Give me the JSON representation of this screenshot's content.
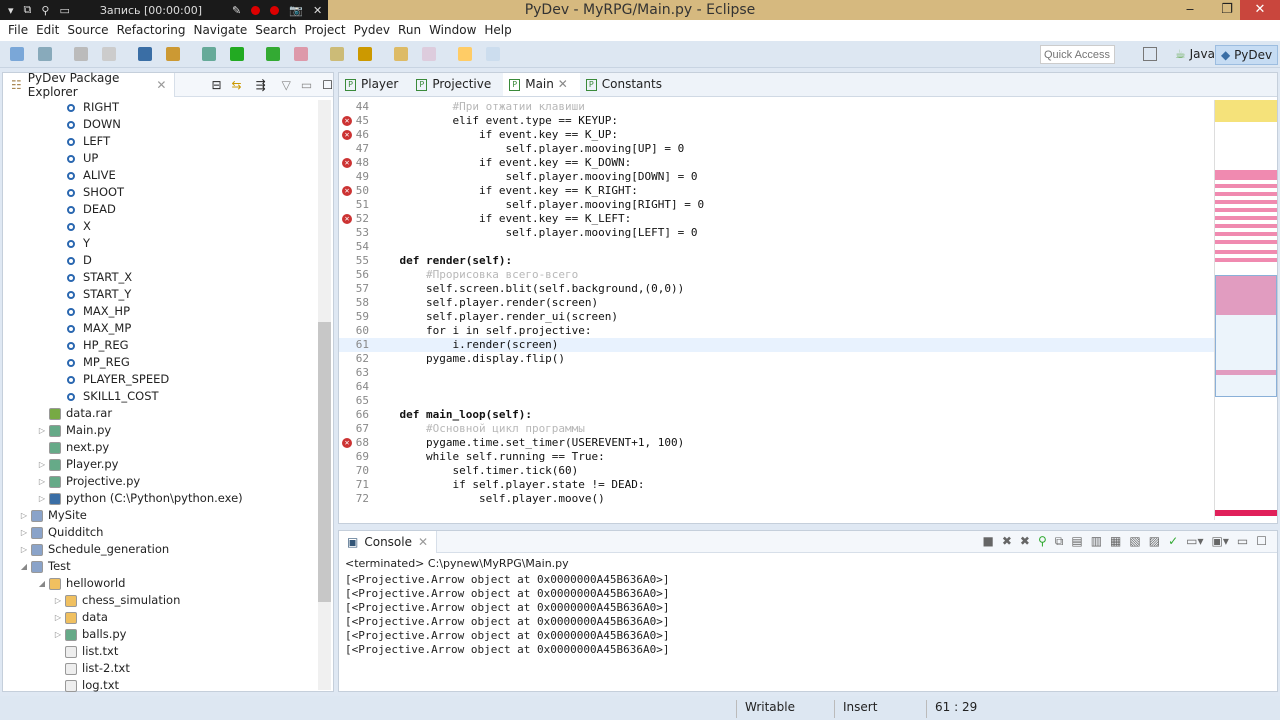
{
  "recorder": {
    "label": "Запись [00:00:00]"
  },
  "window": {
    "title": "PyDev - MyRPG/Main.py - Eclipse",
    "minimize": "‒",
    "restore": "❐",
    "close": "✕"
  },
  "menu": [
    "File",
    "Edit",
    "Source",
    "Refactoring",
    "Navigate",
    "Search",
    "Project",
    "Pydev",
    "Run",
    "Window",
    "Help"
  ],
  "toolbar": {
    "quick_access_placeholder": "Quick Access",
    "perspectives": [
      "Java",
      "PyDev"
    ]
  },
  "explorer": {
    "title": "PyDev Package Explorer",
    "items": [
      {
        "label": "RIGHT",
        "type": "const",
        "indent": 1
      },
      {
        "label": "DOWN",
        "type": "const",
        "indent": 1
      },
      {
        "label": "LEFT",
        "type": "const",
        "indent": 1
      },
      {
        "label": "UP",
        "type": "const",
        "indent": 1
      },
      {
        "label": "ALIVE",
        "type": "const",
        "indent": 1
      },
      {
        "label": "SHOOT",
        "type": "const",
        "indent": 1
      },
      {
        "label": "DEAD",
        "type": "const",
        "indent": 1
      },
      {
        "label": "X",
        "type": "const",
        "indent": 1
      },
      {
        "label": "Y",
        "type": "const",
        "indent": 1
      },
      {
        "label": "D",
        "type": "const",
        "indent": 1
      },
      {
        "label": "START_X",
        "type": "const",
        "indent": 1
      },
      {
        "label": "START_Y",
        "type": "const",
        "indent": 1
      },
      {
        "label": "MAX_HP",
        "type": "const",
        "indent": 1
      },
      {
        "label": "MAX_MP",
        "type": "const",
        "indent": 1
      },
      {
        "label": "HP_REG",
        "type": "const",
        "indent": 1
      },
      {
        "label": "MP_REG",
        "type": "const",
        "indent": 1
      },
      {
        "label": "PLAYER_SPEED",
        "type": "const",
        "indent": 1
      },
      {
        "label": "SKILL1_COST",
        "type": "const",
        "indent": 1
      },
      {
        "label": "data.rar",
        "type": "archive",
        "indent": 0
      },
      {
        "label": "Main.py",
        "type": "py",
        "indent": 0,
        "arrow": true
      },
      {
        "label": "next.py",
        "type": "py",
        "indent": 0
      },
      {
        "label": "Player.py",
        "type": "py",
        "indent": 0,
        "arrow": true
      },
      {
        "label": "Projective.py",
        "type": "py",
        "indent": 0,
        "arrow": true
      },
      {
        "label": "python  (C:\\Python\\python.exe)",
        "type": "python",
        "indent": 0,
        "arrow": true
      },
      {
        "label": "MySite",
        "type": "project",
        "indent": -1,
        "arrow": true
      },
      {
        "label": "Quidditch",
        "type": "project",
        "indent": -1,
        "arrow": true
      },
      {
        "label": "Schedule_generation",
        "type": "project",
        "indent": -1,
        "arrow": true
      },
      {
        "label": "Test",
        "type": "project",
        "indent": -1,
        "arrow": true,
        "open": true
      },
      {
        "label": "helloworld",
        "type": "folder",
        "indent": 0,
        "arrow": true,
        "open": true
      },
      {
        "label": "chess_simulation",
        "type": "folder",
        "indent": 1,
        "arrow": true
      },
      {
        "label": "data",
        "type": "folder",
        "indent": 1,
        "arrow": true
      },
      {
        "label": "balls.py",
        "type": "py",
        "indent": 1,
        "arrow": true
      },
      {
        "label": "list.txt",
        "type": "txt",
        "indent": 1
      },
      {
        "label": "list-2.txt",
        "type": "txt",
        "indent": 1
      },
      {
        "label": "log.txt",
        "type": "txt",
        "indent": 1
      }
    ]
  },
  "editor": {
    "tabs": [
      {
        "label": "Player"
      },
      {
        "label": "Projective"
      },
      {
        "label": "Main",
        "active": true
      },
      {
        "label": "Constants"
      }
    ],
    "current_line": 61,
    "lines": [
      {
        "n": 44,
        "t": "            #При отжатии клавиши"
      },
      {
        "n": 45,
        "t": "            elif event.type == KEYUP:",
        "e": true
      },
      {
        "n": 46,
        "t": "                if event.key == K_UP:",
        "e": true
      },
      {
        "n": 47,
        "t": "                    self.player.mooving[UP] = 0"
      },
      {
        "n": 48,
        "t": "                if event.key == K_DOWN:",
        "e": true
      },
      {
        "n": 49,
        "t": "                    self.player.mooving[DOWN] = 0"
      },
      {
        "n": 50,
        "t": "                if event.key == K_RIGHT:",
        "e": true
      },
      {
        "n": 51,
        "t": "                    self.player.mooving[RIGHT] = 0"
      },
      {
        "n": 52,
        "t": "                if event.key == K_LEFT:",
        "e": true
      },
      {
        "n": 53,
        "t": "                    self.player.mooving[LEFT] = 0"
      },
      {
        "n": 54,
        "t": ""
      },
      {
        "n": 55,
        "t": "    def render(self):"
      },
      {
        "n": 56,
        "t": "        #Прорисовка всего-всего"
      },
      {
        "n": 57,
        "t": "        self.screen.blit(self.background,(0,0))"
      },
      {
        "n": 58,
        "t": "        self.player.render(screen)"
      },
      {
        "n": 59,
        "t": "        self.player.render_ui(screen)"
      },
      {
        "n": 60,
        "t": "        for i in self.projective:"
      },
      {
        "n": 61,
        "t": "            i.render(screen)"
      },
      {
        "n": 62,
        "t": "        pygame.display.flip()"
      },
      {
        "n": 63,
        "t": ""
      },
      {
        "n": 64,
        "t": ""
      },
      {
        "n": 65,
        "t": ""
      },
      {
        "n": 66,
        "t": "    def main_loop(self):"
      },
      {
        "n": 67,
        "t": "        #Основной цикл программы"
      },
      {
        "n": 68,
        "t": "        pygame.time.set_timer(USEREVENT+1, 100)",
        "e": true
      },
      {
        "n": 69,
        "t": "        while self.running == True:"
      },
      {
        "n": 70,
        "t": "            self.timer.tick(60)"
      },
      {
        "n": 71,
        "t": "            if self.player.state != DEAD:"
      },
      {
        "n": 72,
        "t": "                self.player.moove()"
      }
    ]
  },
  "console": {
    "title": "Console",
    "terminated": "<terminated> C:\\pynew\\MyRPG\\Main.py",
    "output": [
      "[<Projective.Arrow object at 0x0000000A45B636A0>]",
      "[<Projective.Arrow object at 0x0000000A45B636A0>]",
      "[<Projective.Arrow object at 0x0000000A45B636A0>]",
      "[<Projective.Arrow object at 0x0000000A45B636A0>]",
      "[<Projective.Arrow object at 0x0000000A45B636A0>]",
      "[<Projective.Arrow object at 0x0000000A45B636A0>]"
    ]
  },
  "status": {
    "mode": "Writable",
    "insert": "Insert",
    "position": "61 : 29"
  }
}
